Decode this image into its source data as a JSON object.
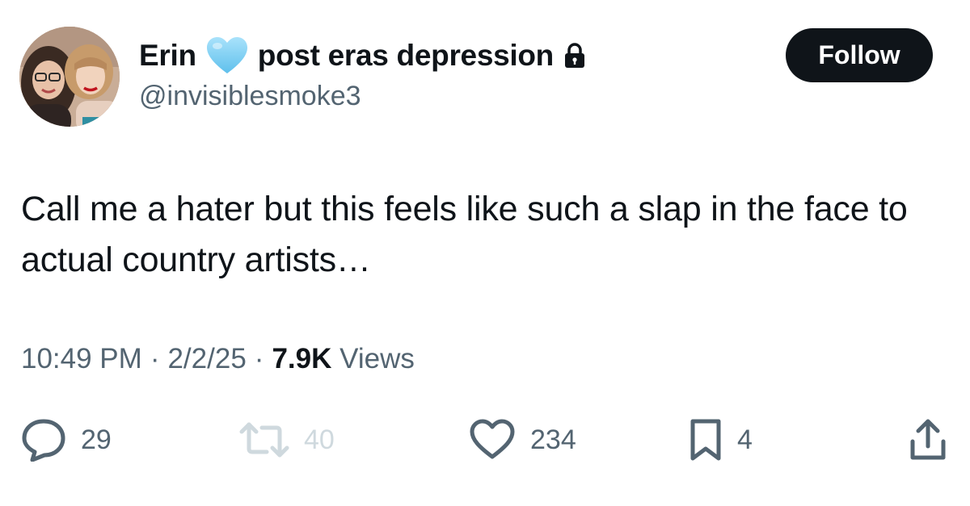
{
  "author": {
    "display_name": "Erin",
    "display_name_suffix": "post eras depression",
    "handle": "@invisiblesmoke3",
    "name_emoji_icon": "light-blue-heart-icon",
    "protected_icon": "lock-icon"
  },
  "follow_button": {
    "label": "Follow"
  },
  "tweet": {
    "text": "Call me a hater but this feels like such a slap in the face to actual country artists…"
  },
  "meta": {
    "time": "10:49 PM",
    "date": "2/2/25",
    "views_count": "7.9K",
    "views_label": "Views",
    "separator": "·"
  },
  "actions": {
    "reply": {
      "icon": "reply-icon",
      "count": "29"
    },
    "retweet": {
      "icon": "retweet-icon",
      "count": "40",
      "disabled": true
    },
    "like": {
      "icon": "heart-icon",
      "count": "234"
    },
    "bookmark": {
      "icon": "bookmark-icon",
      "count": "4"
    },
    "share": {
      "icon": "share-icon"
    }
  },
  "colors": {
    "text_primary": "#0f1419",
    "text_secondary": "#536471",
    "disabled": "#cfd9de",
    "heart_emoji": "#7fd0f4",
    "button_bg": "#0f1419"
  }
}
